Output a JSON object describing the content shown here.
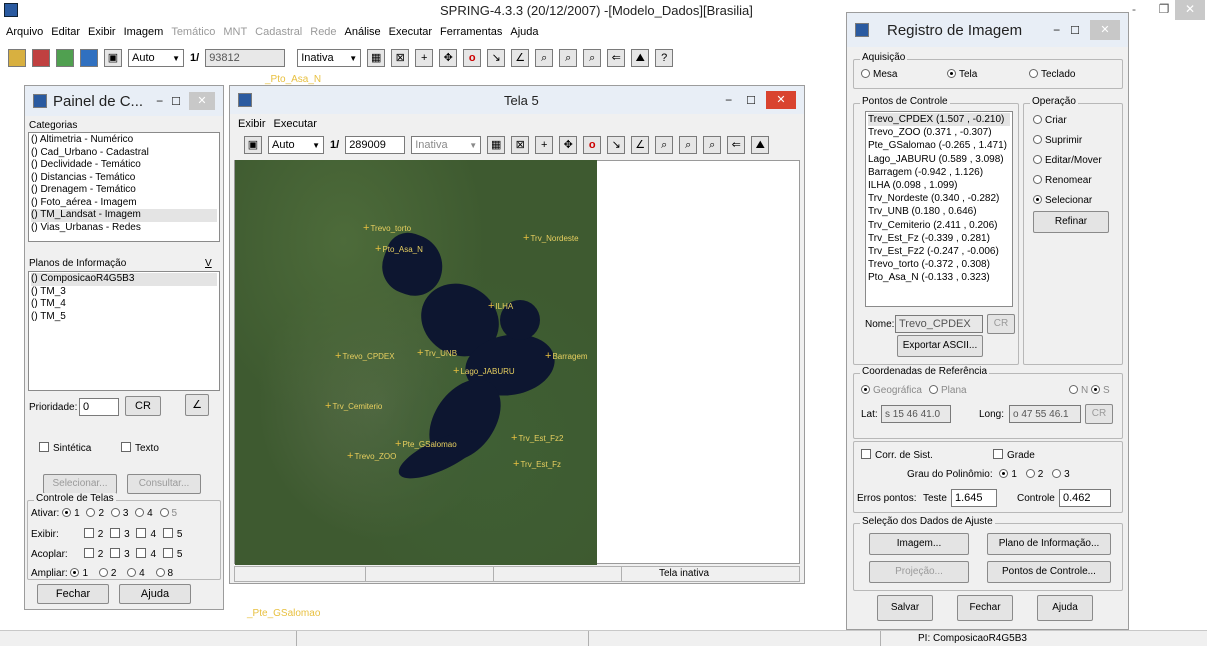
{
  "app": {
    "title": "SPRING-4.3.3 (20/12/2007) -[Modelo_Dados][Brasilia]"
  },
  "menu": [
    "Arquivo",
    "Editar",
    "Exibir",
    "Imagem",
    "Temático",
    "MNT",
    "Cadastral",
    "Rede",
    "Análise",
    "Executar",
    "Ferramentas",
    "Ajuda"
  ],
  "menu_disabled": [
    "Temático",
    "MNT",
    "Cadastral",
    "Rede"
  ],
  "toolbar": {
    "zoom": "Auto",
    "scale_label": "1/",
    "scale_value": "93812",
    "mode": "Inativa"
  },
  "behind_labels": {
    "top": "_Pto_Asa_N",
    "bottom": "_Pte_GSalomao"
  },
  "painel": {
    "title": "Painel de C...",
    "categorias_label": "Categorias",
    "categorias": [
      "() Altimetria - Numérico",
      "() Cad_Urbano - Cadastral",
      "() Declividade - Temático",
      "() Distancias - Temático",
      "() Drenagem - Temático",
      "() Foto_aérea - Imagem",
      "() TM_Landsat - Imagem",
      "() Vias_Urbanas - Redes"
    ],
    "planos_label": "Planos de Informação",
    "planos_v": "V",
    "planos": [
      "() ComposicaoR4G5B3",
      "() TM_3",
      "() TM_4",
      "() TM_5"
    ],
    "prioridade_label": "Prioridade:",
    "prioridade_value": "0",
    "cr": "CR",
    "sintetica": "Sintética",
    "texto": "Texto",
    "selecionar": "Selecionar...",
    "consultar": "Consultar...",
    "controle_label": "Controle de Telas",
    "ativar": "Ativar:",
    "exibir": "Exibir:",
    "acoplar": "Acoplar:",
    "ampliar": "Ampliar:",
    "nums": [
      "1",
      "2",
      "3",
      "4",
      "5"
    ],
    "ampliar_nums": [
      "1",
      "2",
      "4",
      "8"
    ],
    "fechar": "Fechar",
    "ajuda": "Ajuda"
  },
  "tela5": {
    "title": "Tela 5",
    "menu": [
      "Exibir",
      "Executar"
    ],
    "zoom": "Auto",
    "scale_label": "1/",
    "scale_value": "289009",
    "mode": "Inativa",
    "status": "Tela inativa",
    "labels": [
      "Trevo_torto",
      "Trv_Nordeste",
      "Pto_Asa_N",
      "ILHA",
      "Trevo_CPDEX",
      "Trv_UNB",
      "Barragem",
      "Lago_JABURU",
      "Trv_Cemiterio",
      "Pte_GSalomao",
      "Trv_Est_Fz2",
      "Trevo_ZOO",
      "Trv_Est_Fz"
    ]
  },
  "registro": {
    "title": "Registro de Imagem",
    "aquisicao_label": "Aquisição",
    "aquisicao": [
      "Mesa",
      "Tela",
      "Teclado"
    ],
    "pontos_label": "Pontos de Controle",
    "pontos": [
      "Trevo_CPDEX (1.507 , -0.210)",
      "Trevo_ZOO (0.371 , -0.307)",
      "Pte_GSalomao (-0.265 , 1.471)",
      "Lago_JABURU (0.589 , 3.098)",
      "Barragem (-0.942 , 1.126)",
      "ILHA (0.098 , 1.099)",
      "Trv_Nordeste (0.340 , -0.282)",
      "Trv_UNB (0.180 , 0.646)",
      "Trv_Cemiterio (2.411 , 0.206)",
      "Trv_Est_Fz (-0.339 , 0.281)",
      "Trv_Est_Fz2 (-0.247 , -0.006)",
      "Trevo_torto (-0.372 , 0.308)",
      "Pto_Asa_N (-0.133 , 0.323)"
    ],
    "operacao_label": "Operação",
    "operacao": [
      "Criar",
      "Suprimir",
      "Editar/Mover",
      "Renomear",
      "Selecionar"
    ],
    "refinar": "Refinar",
    "nome_label": "Nome:",
    "nome_value": "Trevo_CPDEX",
    "cr": "CR",
    "exportar": "Exportar ASCII...",
    "coord_label": "Coordenadas de Referência",
    "geografica": "Geográfica",
    "plana": "Plana",
    "n": "N",
    "s": "S",
    "lat_label": "Lat:",
    "lat_value": "s 15 46 41.0",
    "long_label": "Long:",
    "long_value": "o 47 55 46.1",
    "corr_sist": "Corr. de Sist.",
    "grade": "Grade",
    "grau_label": "Grau do Polinômio:",
    "grau": [
      "1",
      "2",
      "3"
    ],
    "erros_label": "Erros pontos:",
    "teste_label": "Teste",
    "teste_value": "1.645",
    "controle_label": "Controle",
    "controle_value": "0.462",
    "selecao_label": "Seleção dos Dados de Ajuste",
    "imagem": "Imagem...",
    "plano_info": "Plano de Informação...",
    "projecao": "Projeção...",
    "pontos_controle": "Pontos de Controle...",
    "salvar": "Salvar",
    "fechar": "Fechar",
    "ajuda": "Ajuda"
  },
  "statusbar": {
    "pi": "PI: ComposicaoR4G5B3"
  }
}
